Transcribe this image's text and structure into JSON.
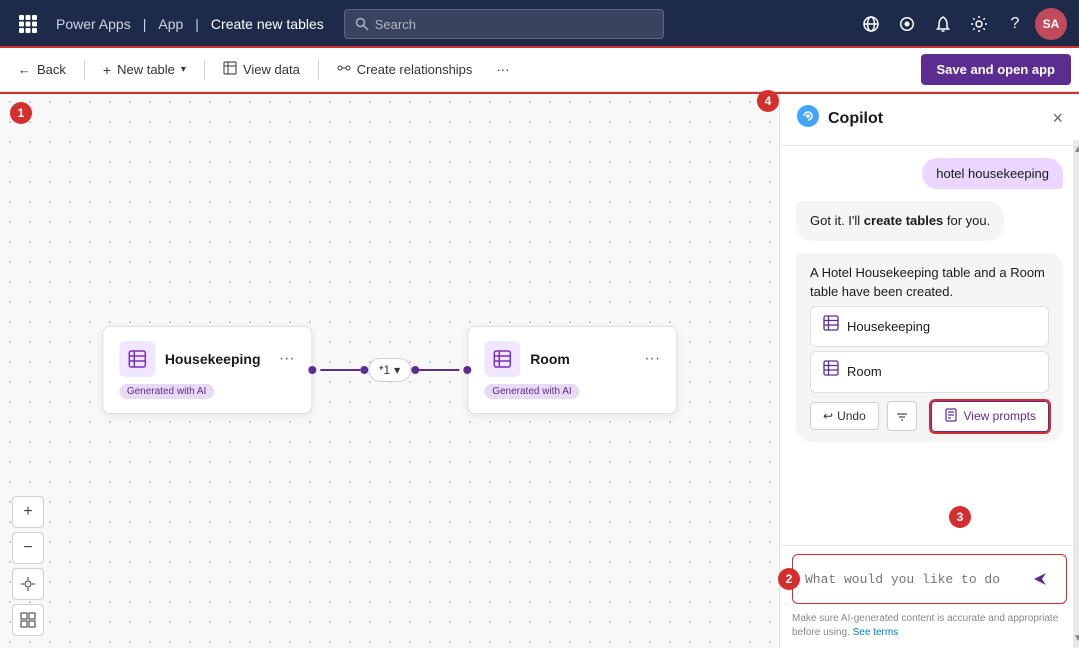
{
  "nav": {
    "app_name": "Power Apps",
    "separator1": "|",
    "app_label": "App",
    "separator2": "|",
    "page_title": "Create new tables",
    "search_placeholder": "Search"
  },
  "toolbar": {
    "back_label": "Back",
    "new_table_label": "New table",
    "view_data_label": "View data",
    "create_relationships_label": "Create relationships",
    "more_label": "...",
    "save_label": "Save and open app"
  },
  "canvas": {
    "badge1": "1",
    "badge4": "4"
  },
  "tables": [
    {
      "name": "Housekeeping",
      "badge": "Generated with AI"
    },
    {
      "name": "Room",
      "badge": "Generated with AI"
    }
  ],
  "relation": {
    "label": "*1",
    "chevron": "▾"
  },
  "copilot": {
    "title": "Copilot",
    "close_label": "×",
    "user_message": "hotel housekeeping",
    "bot_message1_part1": "Got it. I'll ",
    "bot_message1_bold": "create tables",
    "bot_message1_part2": " for you.",
    "bot_message2": "A Hotel Housekeeping table and a Room table have been created.",
    "table1_name": "Housekeeping",
    "table2_name": "Room",
    "undo_label": "Undo",
    "view_prompts_label": "View prompts",
    "input_placeholder": "What would you like to do next?",
    "disclaimer": "Make sure AI-generated content is accurate and appropriate before using.",
    "see_terms": "See terms",
    "badge2": "2",
    "badge3": "3"
  },
  "icons": {
    "grid": "⊞",
    "search": "🔍",
    "globe": "🌐",
    "copilot": "🤖",
    "bell": "🔔",
    "gear": "⚙",
    "help": "?",
    "back_arrow": "←",
    "plus": "+",
    "table_icon": "⊞",
    "undo": "↩",
    "filter": "⇄",
    "send": "➤",
    "view_prompts_icon": "📄",
    "zoom_in": "+",
    "zoom_out": "−",
    "pan": "✥",
    "map": "⊞"
  }
}
